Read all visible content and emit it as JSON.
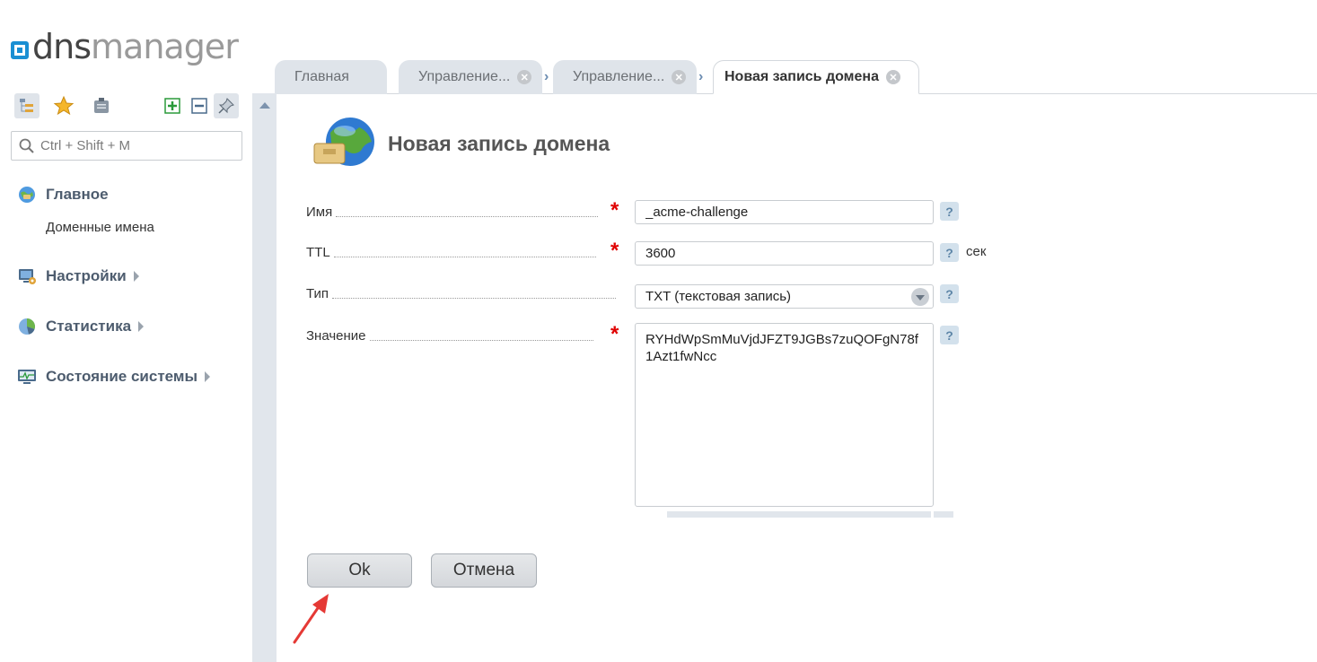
{
  "logo": {
    "part1": "dns",
    "part2": "manager"
  },
  "tabs": [
    {
      "label": "Главная"
    },
    {
      "label": "Управление..."
    },
    {
      "label": "Управление..."
    },
    {
      "label": "Новая запись домена"
    }
  ],
  "sidebar": {
    "search_placeholder": "Ctrl + Shift + M",
    "sections": [
      {
        "label": "Главное",
        "icon": "home-globe-icon",
        "items": [
          "Доменные имена"
        ]
      },
      {
        "label": "Настройки",
        "icon": "settings-monitor-icon"
      },
      {
        "label": "Статистика",
        "icon": "stats-pie-icon"
      },
      {
        "label": "Состояние системы",
        "icon": "system-monitor-icon"
      }
    ]
  },
  "form": {
    "title": "Новая запись домена",
    "fields": {
      "name": {
        "label": "Имя",
        "value": "_acme-challenge",
        "required": true
      },
      "ttl": {
        "label": "TTL",
        "value": "3600",
        "unit": "сек",
        "required": true
      },
      "type": {
        "label": "Тип",
        "value": "TXT (текстовая запись)"
      },
      "value": {
        "label": "Значение",
        "value": "RYHdWpSmMuVjdJFZT9JGBs7zuQOFgN78f1Azt1fwNcc",
        "required": true
      }
    },
    "help_glyph": "?",
    "required_glyph": "*",
    "buttons": {
      "ok": "Ok",
      "cancel": "Отмена"
    }
  },
  "colors": {
    "accent": "#1a8fd3",
    "required": "#e00000",
    "annotation_arrow": "#e53935"
  }
}
